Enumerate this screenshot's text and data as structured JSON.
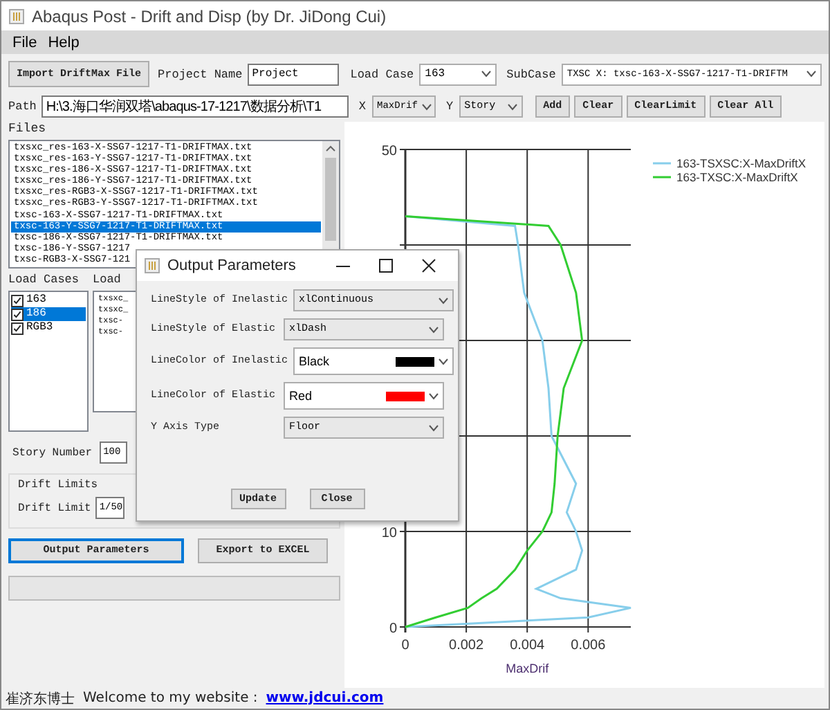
{
  "window": {
    "title": "Abaqus Post - Drift and Disp (by Dr. JiDong Cui)"
  },
  "menu": [
    "File",
    "Help"
  ],
  "toolbar": {
    "import_button": "Import DriftMax File",
    "project_name_label": "Project Name",
    "project_name": "Project",
    "load_case_label": "Load Case",
    "load_case": "163",
    "subcase_label": "SubCase",
    "subcase": "TXSC X: txsc-163-X-SSG7-1217-T1-DRIFTM",
    "path_label": "Path",
    "path": "H:\\3.海口华润双塔\\abaqus-17-1217\\数据分析\\T1",
    "x_label": "X",
    "x_value": "MaxDrif",
    "y_label": "Y",
    "y_value": "Story",
    "buttons": [
      "Add",
      "Clear",
      "ClearLimit",
      "Clear All"
    ]
  },
  "files": {
    "label": "Files",
    "items": [
      {
        "name": "txsxc_res-163-X-SSG7-1217-T1-DRIFTMAX.txt",
        "selected": false
      },
      {
        "name": "txsxc_res-163-Y-SSG7-1217-T1-DRIFTMAX.txt",
        "selected": false
      },
      {
        "name": "txsxc_res-186-X-SSG7-1217-T1-DRIFTMAX.txt",
        "selected": false
      },
      {
        "name": "txsxc_res-186-Y-SSG7-1217-T1-DRIFTMAX.txt",
        "selected": false
      },
      {
        "name": "txsxc_res-RGB3-X-SSG7-1217-T1-DRIFTMAX.txt",
        "selected": false
      },
      {
        "name": "txsxc_res-RGB3-Y-SSG7-1217-T1-DRIFTMAX.txt",
        "selected": false
      },
      {
        "name": "txsc-163-X-SSG7-1217-T1-DRIFTMAX.txt",
        "selected": false
      },
      {
        "name": "txsc-163-Y-SSG7-1217-T1-DRIFTMAX.txt",
        "selected": true
      },
      {
        "name": "txsc-186-X-SSG7-1217-T1-DRIFTMAX.txt",
        "selected": false
      },
      {
        "name": "txsc-186-Y-SSG7-1217",
        "selected": false
      },
      {
        "name": "txsc-RGB3-X-SSG7-121",
        "selected": false
      }
    ]
  },
  "load_cases": {
    "label": "Load Cases",
    "items": [
      {
        "name": "163",
        "checked": true,
        "selected": false
      },
      {
        "name": "186",
        "checked": true,
        "selected": true
      },
      {
        "name": "RGB3",
        "checked": true,
        "selected": false
      }
    ]
  },
  "loads": {
    "label": "Load",
    "items": [
      "txsxc_",
      "txsxc_",
      "txsc-",
      "txsc-"
    ]
  },
  "story_number": {
    "label": "Story Number",
    "value": "100"
  },
  "drift_limits": {
    "label": "Drift Limits",
    "field_label": "Drift Limit",
    "value": "1/50"
  },
  "actions": [
    {
      "label": "Output Parameters",
      "focused": true
    },
    {
      "label": "Export to EXCEL",
      "focused": false
    }
  ],
  "progress": {
    "level": 0
  },
  "chart": {
    "chart_data": {
      "type": "line",
      "orientation": "horizontal",
      "xlabel": "MaxDrif",
      "grid": true,
      "legend": true,
      "x": [
        0,
        1,
        2,
        3,
        4,
        6,
        8,
        10,
        12,
        15,
        20,
        25,
        30,
        35,
        40,
        42,
        43
      ],
      "xlim": [
        0,
        0.0074
      ],
      "ylim": [
        0,
        50
      ],
      "xticks": [
        0,
        0.002,
        0.004,
        0.006
      ],
      "yticks": [
        0,
        10,
        50
      ],
      "series": [
        {
          "name": "163-TSXSC:X-MaxDriftX",
          "color": "#87ceeb",
          "values": [
            0,
            0.006,
            0.0074,
            0.0051,
            0.0043,
            0.0056,
            0.0058,
            0.0056,
            0.0053,
            0.0056,
            0.0048,
            0.0047,
            0.0045,
            0.0039,
            0.0037,
            0.0036,
            0
          ]
        },
        {
          "name": "163-TXSC:X-MaxDriftX",
          "color": "#32cd32",
          "values": [
            0,
            0.001,
            0.00205,
            0.0025,
            0.003,
            0.0036,
            0.004,
            0.0045,
            0.0048,
            0.0049,
            0.005,
            0.0052,
            0.0058,
            0.0056,
            0.0051,
            0.0047,
            0
          ]
        }
      ]
    }
  },
  "dialog": {
    "title": "Output Parameters",
    "rows": [
      {
        "kind": "select",
        "label": "LineStyle of Inelastic",
        "value": "xlContinuous"
      },
      {
        "kind": "select",
        "label": "LineStyle of Elastic",
        "value": "xlDash"
      },
      {
        "kind": "color",
        "label": "LineColor of Inelastic",
        "value": "Black",
        "color": "#000000"
      },
      {
        "kind": "color",
        "label": "LineColor of Elastic",
        "value": "Red",
        "color": "#ff0000"
      },
      {
        "kind": "select",
        "label": "Y Axis Type",
        "value": "Floor"
      }
    ],
    "buttons": [
      "Update",
      "Close"
    ]
  },
  "status_bar": {
    "author": "崔济东博士",
    "message": "Welcome to my website :",
    "link": "www.jdcui.com"
  }
}
